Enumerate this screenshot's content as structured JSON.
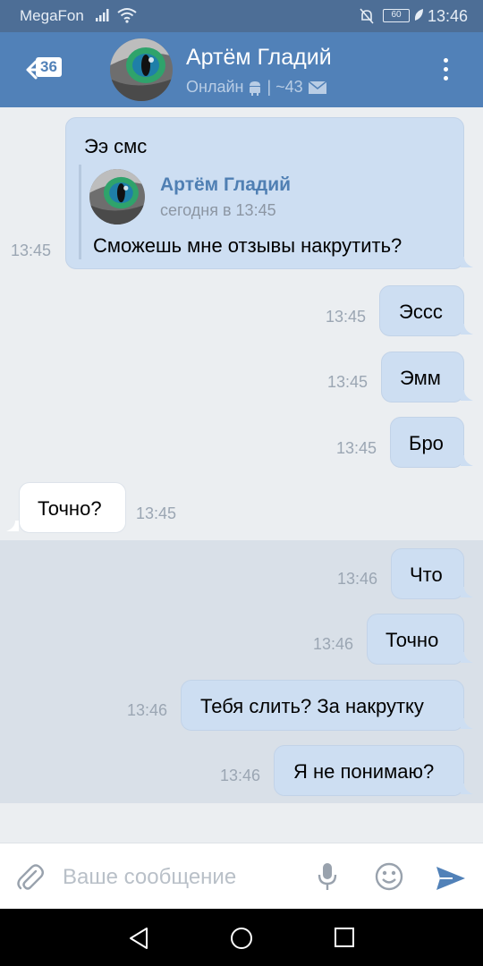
{
  "status_bar": {
    "carrier": "MegaFon",
    "battery": "60",
    "time": "13:46"
  },
  "header": {
    "unread_badge": "36",
    "contact_name": "Артём Гладий",
    "status_text": "Онлайн",
    "separator": "|",
    "counter": "~43"
  },
  "messages": [
    {
      "id": "m1",
      "direction": "out",
      "text": "Ээ смс",
      "time": "13:45",
      "forwarded": {
        "author": "Артём Гладий",
        "date": "сегодня в 13:45",
        "text": "Сможешь мне отзывы накрутить?"
      }
    },
    {
      "id": "m2",
      "direction": "out",
      "text": "Эссс",
      "time": "13:45"
    },
    {
      "id": "m3",
      "direction": "out",
      "text": "Эмм",
      "time": "13:45"
    },
    {
      "id": "m4",
      "direction": "out",
      "text": "Бро",
      "time": "13:45"
    },
    {
      "id": "m5",
      "direction": "in",
      "text": "Точно?",
      "time": "13:45"
    },
    {
      "id": "m6",
      "direction": "out",
      "text": "Что",
      "time": "13:46"
    },
    {
      "id": "m7",
      "direction": "out",
      "text": "Точно",
      "time": "13:46"
    },
    {
      "id": "m8",
      "direction": "out",
      "text": "Тебя слить? За накрутку",
      "time": "13:46"
    },
    {
      "id": "m9",
      "direction": "out",
      "text": "Я не понимаю?",
      "time": "13:46"
    }
  ],
  "input": {
    "placeholder": "Ваше сообщение"
  },
  "icons": {
    "back": "arrow-left-icon",
    "more": "more-vertical-icon",
    "android": "android-icon",
    "mail": "envelope-icon",
    "attach": "paperclip-icon",
    "mic": "microphone-icon",
    "emoji": "smile-icon",
    "send": "send-icon"
  },
  "colors": {
    "header": "#5181b8",
    "status_bar": "#4d6e96",
    "bubble_out": "#cddef2",
    "bubble_in": "#ffffff",
    "link": "#4f7fb3"
  }
}
